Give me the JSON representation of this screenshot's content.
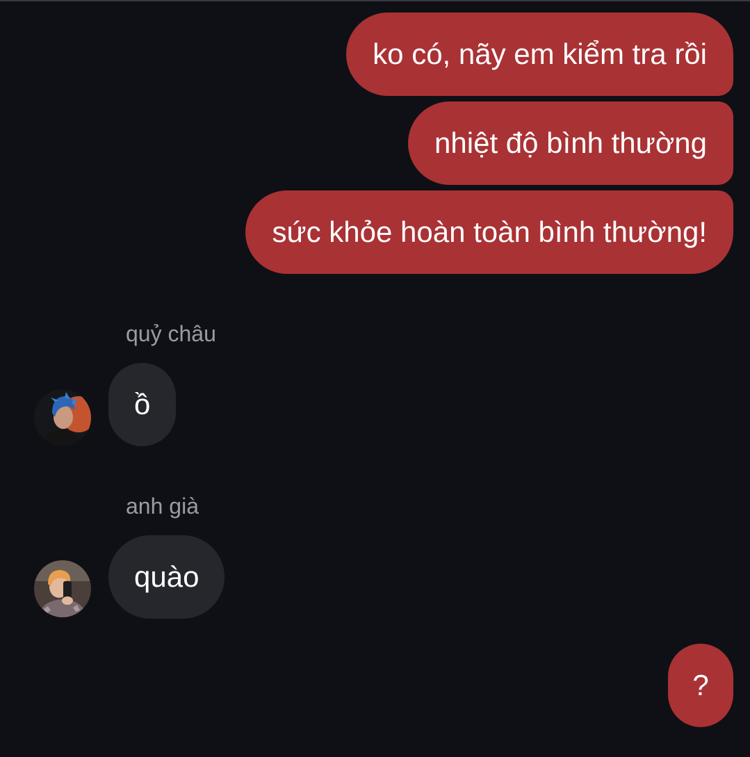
{
  "conversation": {
    "messages": [
      {
        "direction": "outgoing",
        "text": "ko có, nãy em kiểm tra rồi"
      },
      {
        "direction": "outgoing",
        "text": "nhiệt độ bình thường"
      },
      {
        "direction": "outgoing",
        "text": "sức khỏe hoàn toàn bình thường!"
      },
      {
        "direction": "incoming",
        "sender": "quỷ châu",
        "text": "ồ"
      },
      {
        "direction": "incoming",
        "sender": "anh già",
        "text": "quào"
      },
      {
        "direction": "outgoing",
        "text": "?"
      }
    ]
  },
  "colors": {
    "background": "#0f1015",
    "outgoing_bubble": "#a93235",
    "incoming_bubble": "#26272c",
    "sender_name": "#9b9ca3",
    "message_text": "#ffffff"
  },
  "icons": {
    "avatar1": "avatar-blue-hair-profile",
    "avatar2": "avatar-selfie-phone"
  }
}
